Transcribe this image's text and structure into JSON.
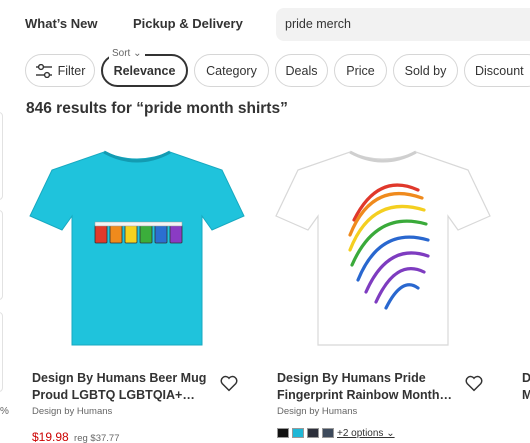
{
  "nav": {
    "whats_new": "What’s New",
    "pickup_delivery": "Pickup & Delivery",
    "search_value": "pride merch"
  },
  "filters": {
    "filter_label": "Filter",
    "sort_label": "Sort ⌄",
    "sort_value": "Relevance",
    "chips": [
      "Category",
      "Deals",
      "Price",
      "Sold by",
      "Discount"
    ]
  },
  "results": {
    "heading": "846 results for “pride month shirts”"
  },
  "products": [
    {
      "title_line1": "Design By Humans Beer Mug",
      "title_line2": "Proud LGBTQ LGBTQIA+…",
      "brand": "Design by Humans",
      "price": "$19.98",
      "reg_price": "reg $37.77",
      "shirt_color": "#1fc3dc"
    },
    {
      "title_line1": "Design By Humans Pride",
      "title_line2": "Fingerprint Rainbow Month…",
      "brand": "Design by Humans",
      "options": "+2 options ⌄",
      "swatches": [
        "#111111",
        "#1fb7d6",
        "#2c2f3a",
        "#3d4a5c",
        "#222222"
      ],
      "shirt_color": "#ffffff"
    },
    {
      "title_line1": "D",
      "title_line2": "M"
    }
  ],
  "edge_glyph": "%",
  "colors": {
    "text": "#333333",
    "price_red": "#cc0000",
    "chip_border": "#d6d6d6",
    "search_bg": "#f2f2f2"
  }
}
